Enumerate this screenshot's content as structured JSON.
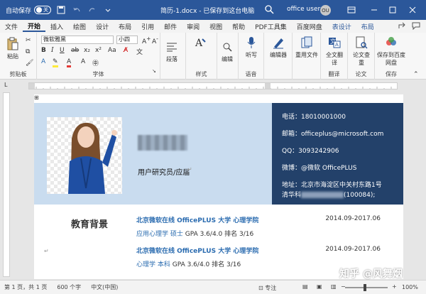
{
  "titlebar": {
    "autosave_label": "自动保存",
    "autosave_state": "关",
    "doc_title": "简历-1.docx - 已保存到这台电脑",
    "user_name": "office user",
    "avatar_initials": "OU",
    "accent": "#2b579a"
  },
  "menu": {
    "items": [
      "文件",
      "开始",
      "插入",
      "绘图",
      "设计",
      "布局",
      "引用",
      "邮件",
      "审阅",
      "视图",
      "帮助",
      "PDF工具集",
      "百度网盘",
      "表设计",
      "布局"
    ],
    "active_index": 1
  },
  "ribbon": {
    "clipboard": {
      "paste": "粘贴",
      "label": "剪贴板"
    },
    "font": {
      "font_name": "微软雅黑",
      "font_size": "小四",
      "label": "字体",
      "wen": "文"
    },
    "paragraph": {
      "label": "段落"
    },
    "style": {
      "label": "样式"
    },
    "editing": {
      "label": "编辑"
    },
    "voice": {
      "button": "听写",
      "label": "语音"
    },
    "editor": {
      "button": "编辑器",
      "label": "编辑器"
    },
    "reuse": {
      "button": "重用文件",
      "label": "重用文件"
    },
    "translate": {
      "button": "全文翻译",
      "label": "翻译"
    },
    "check": {
      "button": "论文查重",
      "label": "论文"
    },
    "save_cloud": {
      "button": "保存到百度网盘",
      "label": "保存"
    }
  },
  "resume": {
    "job": "用户研究员/应届",
    "phone": "电话：18010001000",
    "email": "邮箱：officeplus@microsoft.com",
    "qq": "QQ：3093242906",
    "weibo": "微博：@微软 OfficePLUS",
    "address1": "地址：北京市海淀区中关村东路1号",
    "address2": "清华科",
    "address2_tail": "(100084);",
    "band_color": "#c9dcef",
    "contact_color": "#23416a",
    "education_title": "教育背景",
    "education": [
      {
        "school": "北京微软在线 OfficePLUS 大学  心理学院",
        "major": "应用心理学  硕士",
        "gpa": "GPA 3.6/4.0   排名 3/16",
        "dates": "2014.09-2017.06"
      },
      {
        "school": "北京微软在线 OfficePLUS 大学  心理学院",
        "major": "心理学    本科",
        "gpa": "GPA 3.6/4.0   排名 3/16",
        "dates": "2014.09-2017.06"
      }
    ]
  },
  "status": {
    "page": "第 1 页，共 1 页",
    "words": "600 个字",
    "language": "中文(中国)",
    "focus": "专注",
    "zoom": "100%"
  },
  "watermark": "知乎 @风舞烟"
}
